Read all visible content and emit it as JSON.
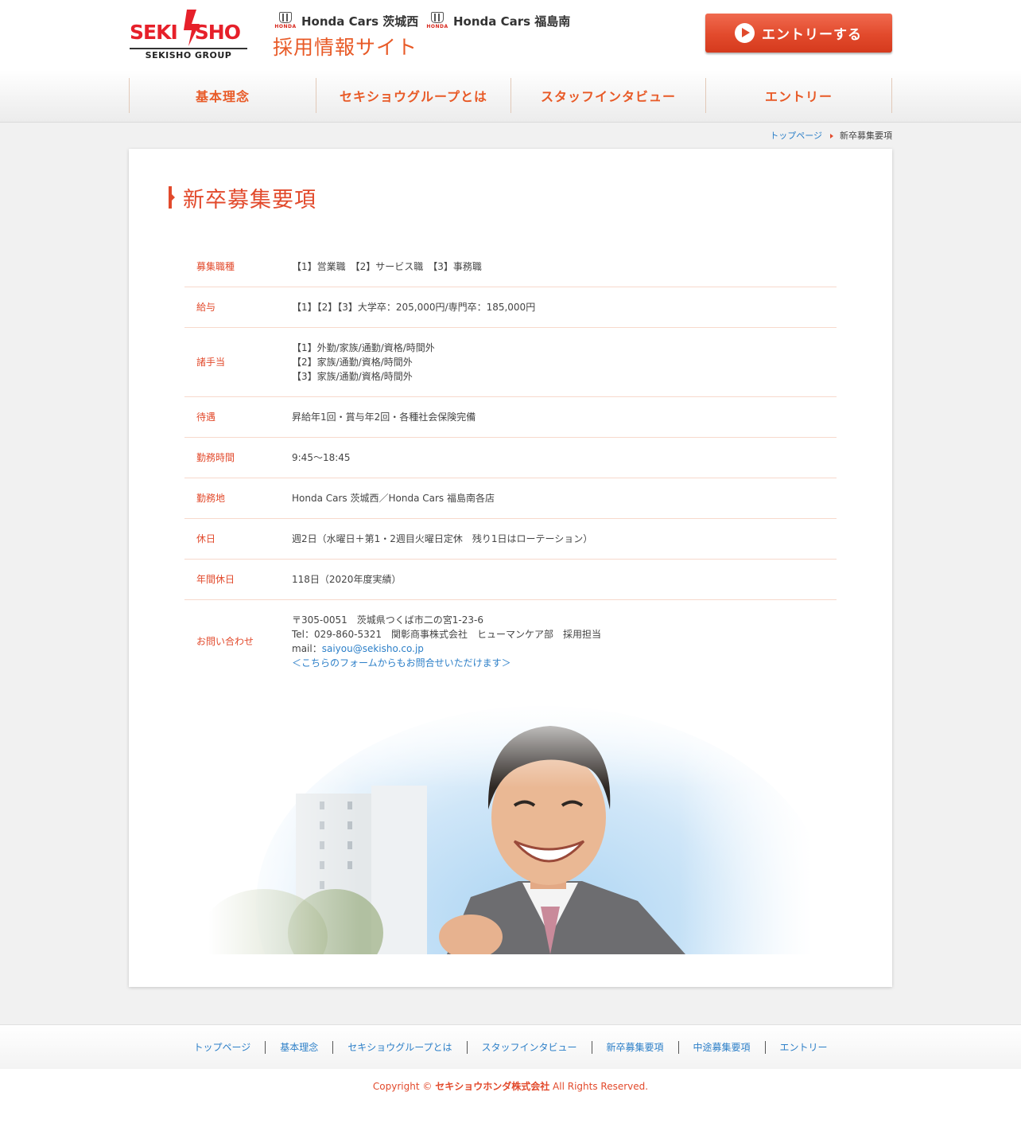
{
  "header": {
    "logo_main_left": "SEKI",
    "logo_main_right": "SHO",
    "logo_sub": "SEKISHO GROUP",
    "honda_word": "HONDA",
    "brand1": "Honda Cars 茨城西",
    "brand2": "Honda Cars 福島南",
    "site_title": "採用情報サイト",
    "entry_button": "エントリーする"
  },
  "nav": {
    "items": [
      {
        "label": "基本理念"
      },
      {
        "label": "セキショウグループとは"
      },
      {
        "label": "スタッフインタビュー"
      },
      {
        "label": "エントリー"
      }
    ]
  },
  "breadcrumb": {
    "home": "トップページ",
    "current": "新卒募集要項"
  },
  "page": {
    "title": "新卒募集要項"
  },
  "table": {
    "rows": [
      {
        "label": "募集職種",
        "lines": [
          "【1】営業職　【2】サービス職　【3】事務職"
        ]
      },
      {
        "label": "給与",
        "lines": [
          "【1】【2】【3】大学卒：205,000円/専門卒：185,000円"
        ]
      },
      {
        "label": "諸手当",
        "lines": [
          "【1】外勤/家族/通勤/資格/時間外",
          "【2】家族/通勤/資格/時間外",
          "【3】家族/通勤/資格/時間外"
        ]
      },
      {
        "label": "待遇",
        "lines": [
          "昇給年1回・賞与年2回・各種社会保険完備"
        ]
      },
      {
        "label": "勤務時間",
        "lines": [
          "9:45～18:45"
        ]
      },
      {
        "label": "勤務地",
        "lines": [
          "Honda Cars 茨城西／Honda Cars 福島南各店"
        ]
      },
      {
        "label": "休日",
        "lines": [
          "週2日（水曜日＋第1・2週目火曜日定休　残り1日はローテーション）"
        ]
      },
      {
        "label": "年間休日",
        "lines": [
          "118日（2020年度実績）"
        ]
      }
    ],
    "contact": {
      "label": "お問い合わせ",
      "address": "〒305-0051　茨城県つくば市二の宮1-23-6",
      "tel": "Tel：029-860-5321　関彰商事株式会社　ヒューマンケア部　採用担当",
      "mail_prefix": "mail：",
      "mail": "saiyou@sekisho.co.jp",
      "form_link": "＜こちらのフォームからもお問合せいただけます＞"
    }
  },
  "footer": {
    "links": [
      "トップページ",
      "基本理念",
      "セキショウグループとは",
      "スタッフインタビュー",
      "新卒募集要項",
      "中途募集要項",
      "エントリー"
    ],
    "copyright_prefix": "Copyright ©",
    "company": "セキショウホンダ株式会社",
    "copyright_suffix": "All Rights Reserved."
  },
  "colors": {
    "accent": "#e24a2c",
    "link": "#2c7fc8",
    "logo_red": "#e6202a"
  }
}
